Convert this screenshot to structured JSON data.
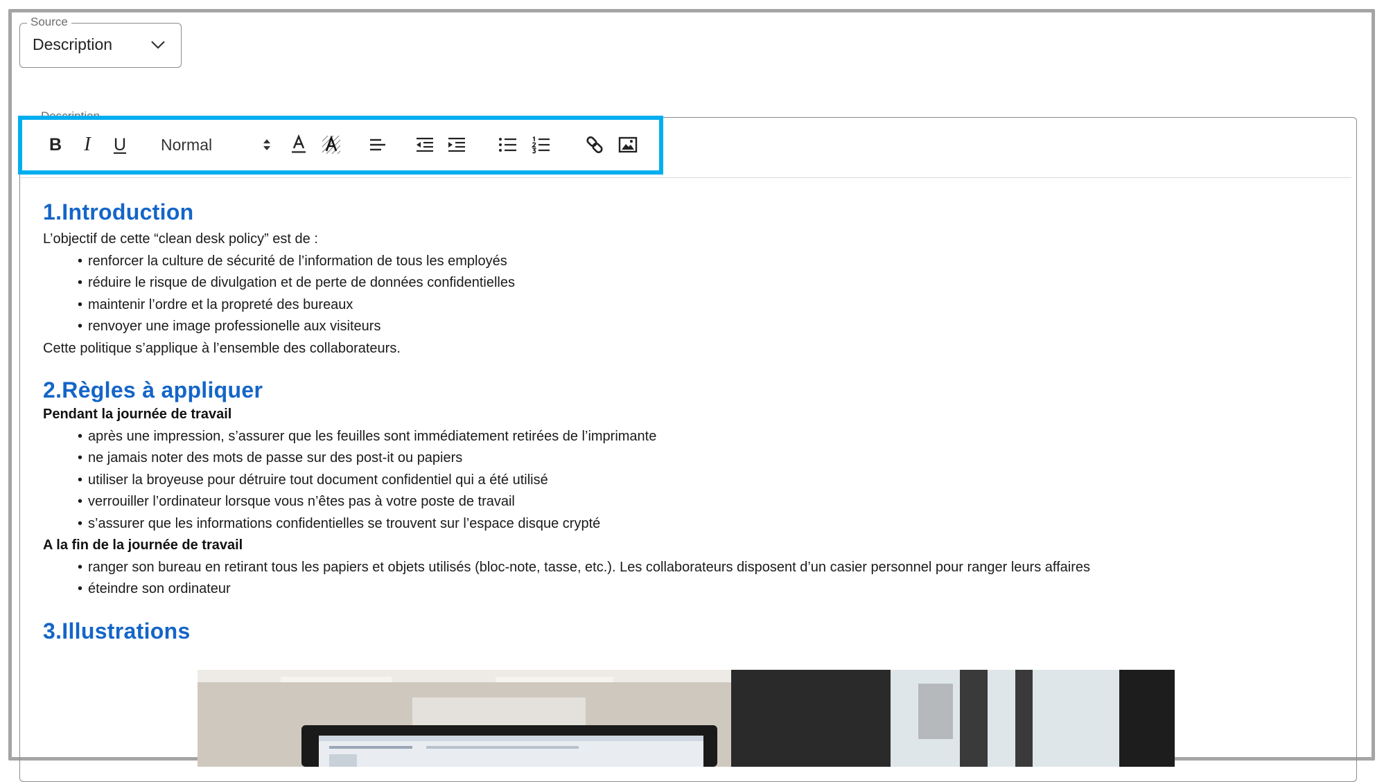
{
  "source": {
    "legend": "Source",
    "value": "Description"
  },
  "editor": {
    "label": "Description"
  },
  "toolbar": {
    "bold": "B",
    "italic": "I",
    "underline": "U",
    "style_select": "Normal",
    "icons": [
      "bold-icon",
      "italic-icon",
      "underline-icon",
      "text-color-icon",
      "background-color-icon",
      "align-left-icon",
      "outdent-icon",
      "indent-icon",
      "bullet-list-icon",
      "numbered-list-icon",
      "link-icon",
      "image-icon"
    ],
    "highlight_color": "#00aeef"
  },
  "content": {
    "heading_color": "#1465c8",
    "sections": [
      {
        "heading": "1.Introduction",
        "intro": "L’objectif de cette “clean desk policy” est de :",
        "bullets": [
          "renforcer la culture de sécurité de l’information de tous les employés",
          "réduire le risque de divulgation et de perte de données confidentielles",
          "maintenir l’ordre et la propreté des bureaux",
          "renvoyer une image professionelle aux visiteurs"
        ],
        "outro": "Cette politique s’applique à l’ensemble des collaborateurs."
      },
      {
        "heading": "2.Règles à appliquer",
        "sub1": "Pendant la journée de travail",
        "bullets1": [
          "après une impression, s’assurer que les feuilles sont immédiatement retirées de l’imprimante",
          "ne jamais noter des mots de passe sur des post-it ou papiers",
          "utiliser la broyeuse pour détruire tout document confidentiel qui a été utilisé",
          "verrouiller l’ordinateur lorsque vous n’êtes pas à votre poste de travail",
          "s’assurer que les informations confidentielles se trouvent sur l’espace disque crypté"
        ],
        "sub2": "A la fin de la journée de travail",
        "bullets2": [
          "ranger son bureau en retirant tous les papiers et objets utilisés (bloc-note, tasse, etc.). Les collaborateurs disposent d’un casier personnel pour ranger leurs affaires",
          "éteindre son ordinateur"
        ]
      },
      {
        "heading": "3.Illustrations"
      }
    ]
  }
}
